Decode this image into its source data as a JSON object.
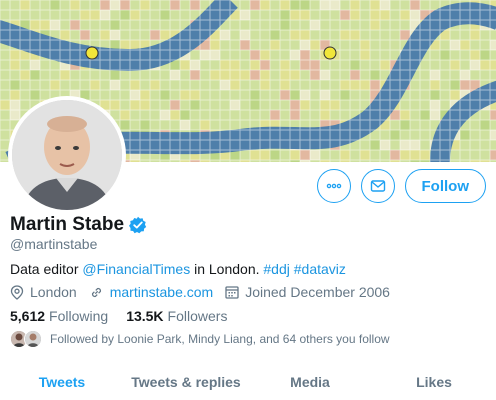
{
  "profile": {
    "display_name": "Martin Stabe",
    "handle": "@martinstabe",
    "verified": true,
    "verified_icon": "verified-badge-icon"
  },
  "actions": {
    "more_icon": "more-horizontal-icon",
    "message_icon": "envelope-icon",
    "follow_label": "Follow"
  },
  "bio": {
    "text_before": "Data editor ",
    "mention": "@FinancialTimes",
    "text_middle": " in London. ",
    "hashtag1": "#ddj",
    "space": " ",
    "hashtag2": "#dataviz"
  },
  "meta": {
    "location": "London",
    "location_icon": "location-pin-icon",
    "website": "martinstabe.com",
    "website_icon": "link-icon",
    "joined": "Joined December 2006",
    "joined_icon": "calendar-icon"
  },
  "stats": {
    "following_count": "5,612",
    "following_label": "Following",
    "followers_count": "13.5K",
    "followers_label": "Followers"
  },
  "followed_by": {
    "text": "Followed by Loonie Park, Mindy Liang, and 64 others you follow"
  },
  "tabs": [
    {
      "label": "Tweets",
      "active": true
    },
    {
      "label": "Tweets & replies",
      "active": false
    },
    {
      "label": "Media",
      "active": false
    },
    {
      "label": "Likes",
      "active": false
    }
  ],
  "colors": {
    "accent": "#1da1f2",
    "link": "#1b95e0",
    "secondary_text": "#657786",
    "river": "#4f7faa",
    "map_green": "#c8dd94",
    "map_yellow": "#e6e08f",
    "map_pink": "#e8a9a0"
  }
}
